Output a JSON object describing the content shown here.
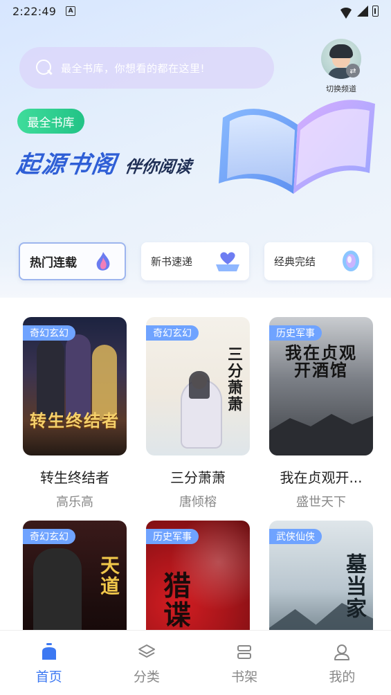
{
  "status_bar": {
    "time": "2:22:49",
    "a_badge": "A"
  },
  "search": {
    "placeholder": "最全书库，你想看的都在这里!"
  },
  "channel_switch": {
    "label": "切换频道",
    "avatar_icon": "avatar-icon",
    "swap_icon": "swap-icon"
  },
  "banner": {
    "tag": "最全书库",
    "brand": "起源书阁",
    "slogan": "伴你阅读"
  },
  "categories": [
    {
      "label": "热门连载",
      "icon": "flame-icon",
      "active": true
    },
    {
      "label": "新书速递",
      "icon": "heart-icon",
      "active": false
    },
    {
      "label": "经典完结",
      "icon": "ring-icon",
      "active": false
    }
  ],
  "books": [
    {
      "genre": "奇幻玄幻",
      "title": "转生终结者",
      "author": "高乐高",
      "cover_text": "转生终结者"
    },
    {
      "genre": "奇幻玄幻",
      "title": "三分萧萧",
      "author": "唐倾榕",
      "cover_text": "三分萧萧"
    },
    {
      "genre": "历史军事",
      "title": "我在贞观开...",
      "author": "盛世天下",
      "cover_text": "我在贞观开酒馆"
    },
    {
      "genre": "奇幻玄幻",
      "title": "",
      "author": "",
      "cover_text": "天道"
    },
    {
      "genre": "历史军事",
      "title": "",
      "author": "",
      "cover_text": "猎谍"
    },
    {
      "genre": "武侠仙侠",
      "title": "",
      "author": "",
      "cover_text": "墓当家"
    }
  ],
  "tabbar": [
    {
      "label": "首页",
      "icon": "home-icon",
      "active": true
    },
    {
      "label": "分类",
      "icon": "layers-icon",
      "active": false
    },
    {
      "label": "书架",
      "icon": "bookshelf-icon",
      "active": false
    },
    {
      "label": "我的",
      "icon": "user-icon",
      "active": false
    }
  ],
  "colors": {
    "accent": "#3c78f2",
    "brand": "#2f5fd6",
    "tag_green": "#2cd08f",
    "genre_tag": "#6fa3ff"
  }
}
